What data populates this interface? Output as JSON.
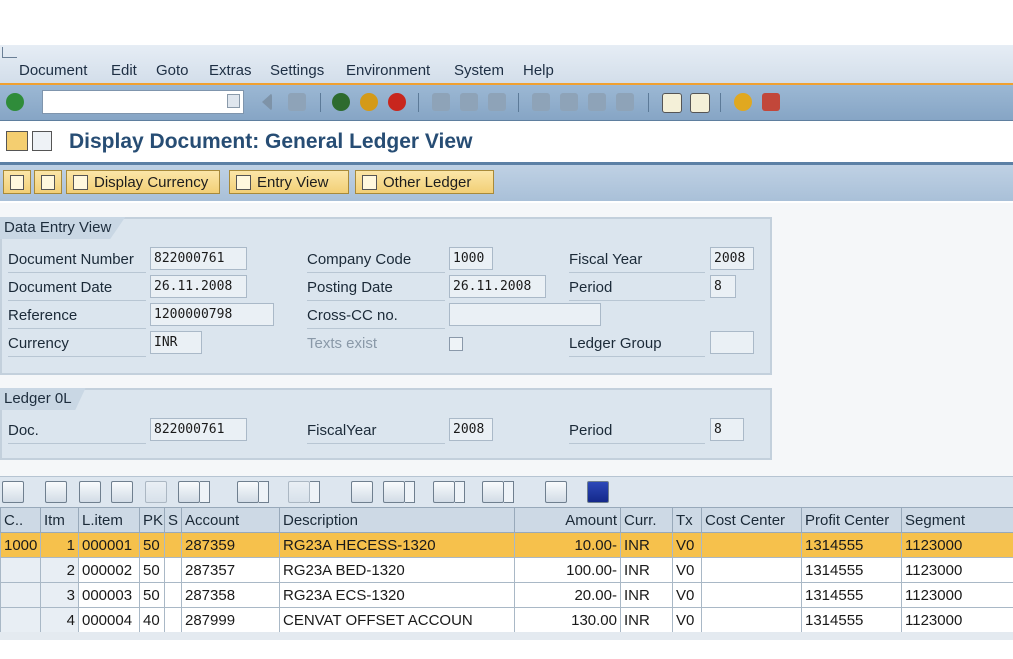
{
  "menu": [
    "Document",
    "Edit",
    "Goto",
    "Extras",
    "Settings",
    "Environment",
    "System",
    "Help"
  ],
  "title": "Display Document: General Ledger View",
  "app_buttons": {
    "display_currency": "Display Currency",
    "entry_view": "Entry View",
    "other_ledger": "Other Ledger"
  },
  "data_entry": {
    "tab": "Data Entry View",
    "doc_number_label": "Document Number",
    "doc_number": "822000761",
    "company_code_label": "Company Code",
    "company_code": "1000",
    "fiscal_year_label": "Fiscal Year",
    "fiscal_year": "2008",
    "doc_date_label": "Document Date",
    "doc_date": "26.11.2008",
    "posting_date_label": "Posting Date",
    "posting_date": "26.11.2008",
    "period_label": "Period",
    "period": "8",
    "reference_label": "Reference",
    "reference": "1200000798",
    "cross_cc_label": "Cross-CC no.",
    "cross_cc": "",
    "currency_label": "Currency",
    "currency": "INR",
    "texts_exist_label": "Texts exist",
    "ledger_group_label": "Ledger Group",
    "ledger_group": ""
  },
  "ledger": {
    "tab": "Ledger 0L",
    "doc_label": "Doc.",
    "doc": "822000761",
    "fiscal_year_label": "FiscalYear",
    "fiscal_year": "2008",
    "period_label": "Period",
    "period": "8"
  },
  "table": {
    "headers": [
      "C..",
      "Itm",
      "L.item",
      "PK",
      "S",
      "Account",
      "Description",
      "Amount",
      "Curr.",
      "Tx",
      "Cost Center",
      "Profit Center",
      "Segment"
    ],
    "rows": [
      [
        "1000",
        "1",
        "000001",
        "50",
        "",
        "287359",
        "RG23A HECESS-1320",
        "10.00-",
        "INR",
        "V0",
        "",
        "1314555",
        "1123000"
      ],
      [
        "",
        "2",
        "000002",
        "50",
        "",
        "287357",
        "RG23A BED-1320",
        "100.00-",
        "INR",
        "V0",
        "",
        "1314555",
        "1123000"
      ],
      [
        "",
        "3",
        "000003",
        "50",
        "",
        "287358",
        "RG23A ECS-1320",
        "20.00-",
        "INR",
        "V0",
        "",
        "1314555",
        "1123000"
      ],
      [
        "",
        "4",
        "000004",
        "40",
        "",
        "287999",
        "CENVAT OFFSET ACCOUN",
        "130.00",
        "INR",
        "V0",
        "",
        "1314555",
        "1123000"
      ]
    ]
  },
  "colors": {
    "accent": "#274d74",
    "selected_row": "#f6c14c",
    "toolbar": "#9cb8d4"
  }
}
